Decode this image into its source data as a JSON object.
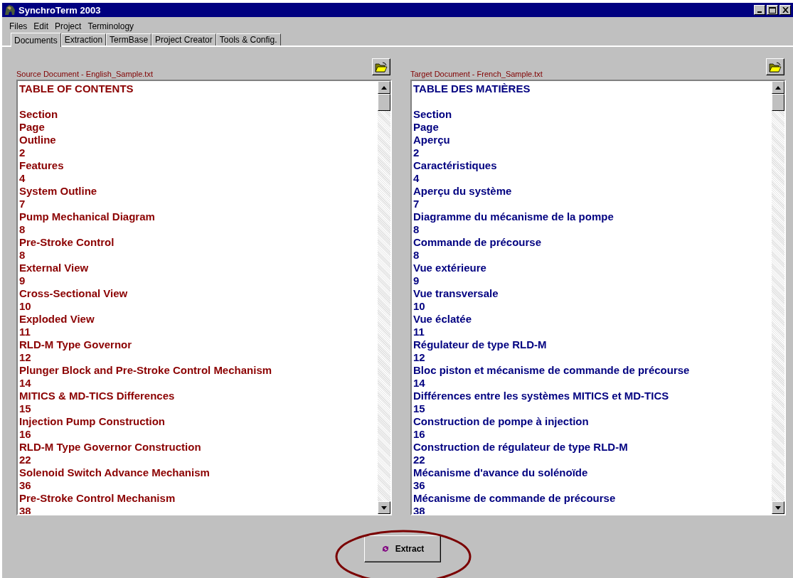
{
  "window": {
    "title": "SynchroTerm 2003"
  },
  "menu": [
    "Files",
    "Edit",
    "Project",
    "Terminology"
  ],
  "tabs": [
    {
      "label": "Documents",
      "selected": true
    },
    {
      "label": "Extraction",
      "selected": false
    },
    {
      "label": "TermBase",
      "selected": false
    },
    {
      "label": "Project Creator",
      "selected": false
    },
    {
      "label": "Tools & Config.",
      "selected": false
    }
  ],
  "panels": [
    {
      "kind": "source",
      "label": "Source Document - English_Sample.txt",
      "heading": "TABLE OF CONTENTS",
      "lines": [
        "Section",
        "Page",
        "Outline",
        "2",
        "Features",
        "4",
        "System Outline",
        "7",
        "Pump Mechanical Diagram",
        "8",
        "Pre-Stroke Control",
        "8",
        "External View",
        "9",
        "Cross-Sectional View",
        "10",
        "Exploded View",
        "11",
        "RLD-M Type Governor",
        "12",
        "Plunger Block and Pre-Stroke Control Mechanism",
        "14",
        "MITICS & MD-TICS Differences",
        "15",
        "Injection Pump Construction",
        "16",
        "RLD-M Type Governor Construction",
        "22",
        "Solenoid Switch Advance Mechanism",
        "36",
        "Pre-Stroke Control Mechanism",
        "38"
      ]
    },
    {
      "kind": "target",
      "label": "Target Document - French_Sample.txt",
      "heading": "TABLE DES MATIÈRES",
      "lines": [
        "Section",
        "Page",
        "Aperçu",
        "2",
        "Caractéristiques",
        "4",
        "Aperçu du système",
        "7",
        "Diagramme du mécanisme de la pompe",
        "8",
        "Commande de précourse",
        "8",
        "Vue extérieure",
        "9",
        "Vue transversale",
        "10",
        "Vue éclatée",
        "11",
        "Régulateur de type RLD-M",
        "12",
        "Bloc piston et mécanisme de commande de précourse",
        "14",
        "Différences entre les systèmes MITICS et MD-TICS",
        "15",
        "Construction de pompe à injection",
        "16",
        "Construction de régulateur de type RLD-M",
        "22",
        "Mécanisme d'avance du solénoïde",
        "36",
        "Mécanisme de commande de précourse",
        "38"
      ]
    }
  ],
  "extract_button": {
    "label": "Extract"
  }
}
